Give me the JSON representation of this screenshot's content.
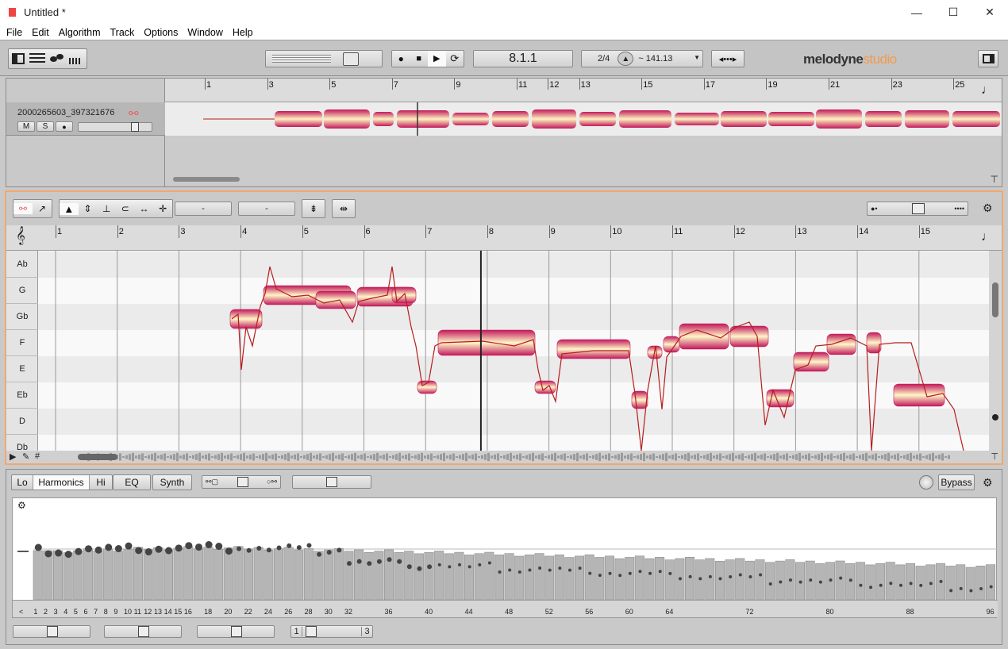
{
  "window": {
    "title": "Untitled *",
    "minimize": "—",
    "maximize": "☐",
    "close": "✕"
  },
  "menu": [
    "File",
    "Edit",
    "Algorithm",
    "Track",
    "Options",
    "Window",
    "Help"
  ],
  "transport": {
    "position": "8.1.1",
    "time_signature": "2/4",
    "tempo": "~ 141.13"
  },
  "brand": {
    "name": "melodyne",
    "edition": "studio",
    "edition_color": "#f29a4a"
  },
  "track": {
    "name": "2000265603_397321676",
    "mute": "M",
    "solo": "S"
  },
  "arrange_ruler": [
    {
      "label": "1",
      "bar": 1
    },
    {
      "label": "3",
      "bar": 3
    },
    {
      "label": "5",
      "bar": 5
    },
    {
      "label": "7",
      "bar": 7
    },
    {
      "label": "9",
      "bar": 9
    },
    {
      "label": "11",
      "bar": 11
    },
    {
      "label": "12",
      "bar": 12
    },
    {
      "label": "13",
      "bar": 13
    },
    {
      "label": "15",
      "bar": 15
    },
    {
      "label": "17",
      "bar": 17
    },
    {
      "label": "19",
      "bar": 19
    },
    {
      "label": "21",
      "bar": 21
    },
    {
      "label": "23",
      "bar": 23
    },
    {
      "label": "25",
      "bar": 25
    }
  ],
  "editor": {
    "field1": "-",
    "field2": "-",
    "playhead_bar": 8,
    "ruler": [
      "1",
      "2",
      "3",
      "4",
      "5",
      "6",
      "7",
      "8",
      "9",
      "10",
      "11",
      "12",
      "13",
      "14",
      "15"
    ],
    "pitches": [
      "Ab",
      "G",
      "Gb",
      "F",
      "E",
      "Eb",
      "D",
      "Db"
    ]
  },
  "sound_editor": {
    "tabs": [
      "Lo",
      "Harmonics",
      "Hi",
      "EQ",
      "Synth"
    ],
    "active_tab": "Harmonics",
    "bypass": "Bypass",
    "harmonic_labels": [
      "<",
      "1",
      "2",
      "3",
      "4",
      "5",
      "6",
      "7",
      "8",
      "9",
      "10",
      "11",
      "12",
      "13",
      "14",
      "15",
      "16",
      "18",
      "20",
      "22",
      "24",
      "26",
      "28",
      "30",
      "32",
      "36",
      "40",
      "44",
      "48",
      "52",
      "56",
      "60",
      "64",
      "72",
      "80",
      "88",
      "96"
    ],
    "stepper": {
      "min": "1",
      "max": "3"
    }
  }
}
